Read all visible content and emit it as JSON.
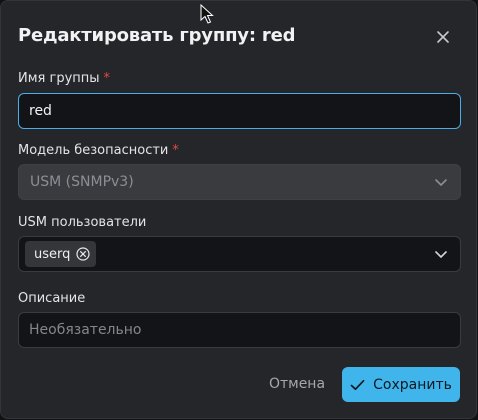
{
  "dialog": {
    "title": "Редактировать группу: red",
    "close_icon": "close-icon"
  },
  "form": {
    "group_name": {
      "label": "Имя группы",
      "required_mark": "*",
      "value": "red"
    },
    "security_model": {
      "label": "Модель безопасности",
      "required_mark": "*",
      "value": "USM (SNMPv3)",
      "disabled": true
    },
    "usm_users": {
      "label": "USM пользователи",
      "chips": [
        "userq"
      ]
    },
    "description": {
      "label": "Описание",
      "value": "",
      "placeholder": "Необязательно"
    }
  },
  "actions": {
    "cancel_label": "Отмена",
    "save_label": "Сохранить",
    "save_icon": "check-icon"
  },
  "colors": {
    "accent": "#3fb5ec",
    "required": "#e5484d",
    "focus_border": "#4aaee8"
  }
}
